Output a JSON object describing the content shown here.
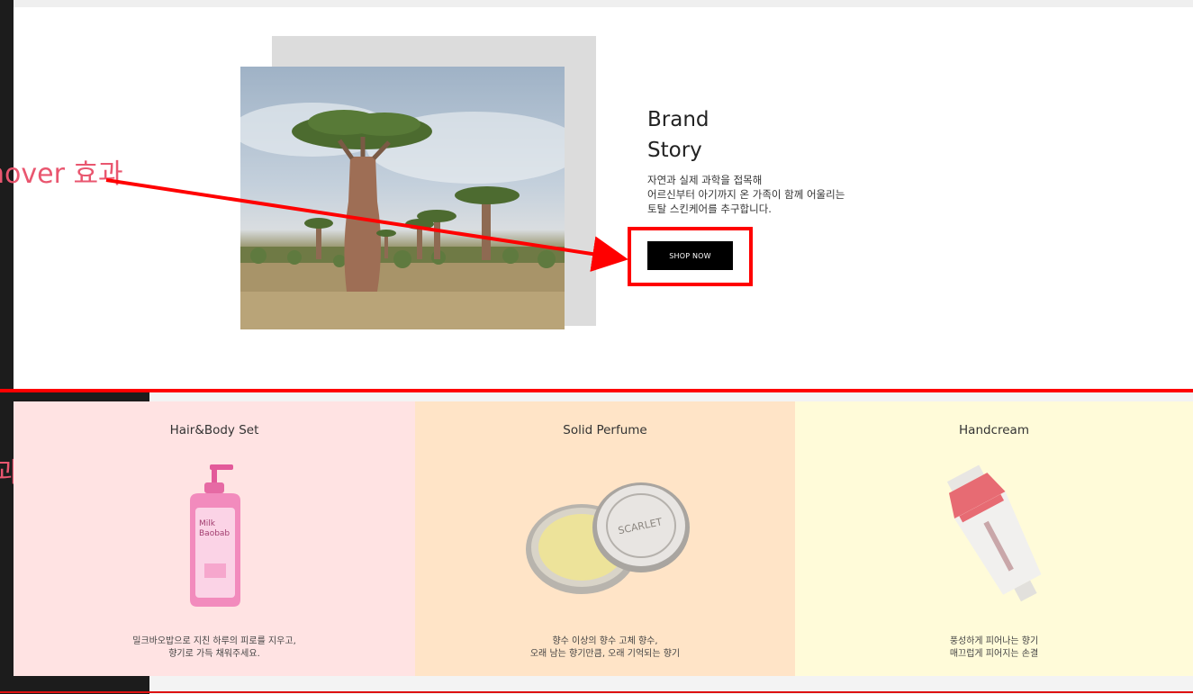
{
  "hero": {
    "title_line1": "Brand",
    "title_line2": "Story",
    "description": [
      "자연과 실제 과학을 접목해",
      "어르신부터 아기까지 온 가족이 함께 어울리는",
      "토탈 스킨케어를 추구합니다."
    ],
    "button_label": "SHOP NOW"
  },
  "annotations": {
    "hover_label": "hover 효과",
    "partial_label": "과"
  },
  "products": [
    {
      "title": "Hair&Body Set",
      "description": [
        "밀크바오밥으로 지친 하루의 피로를 지우고,",
        "향기로 가득 채워주세요."
      ],
      "bg": "#ffe3e3",
      "product_text": [
        "Milk",
        "Baobab"
      ]
    },
    {
      "title": "Solid Perfume",
      "description": [
        "향수 이상의 향수 고체 향수,",
        "오래 남는 향기만큼, 오래 기억되는 향기"
      ],
      "bg": "#ffe4c7",
      "product_text": [
        "SCARLET"
      ]
    },
    {
      "title": "Handcream",
      "description": [
        "풍성하게 피어나는 향기",
        "매끄럽게 피어지는 손결"
      ],
      "bg": "#fffbd9"
    }
  ],
  "colors": {
    "accent_red": "#ff0000",
    "annotation_pink": "#e9566f",
    "button_bg": "#000000"
  }
}
